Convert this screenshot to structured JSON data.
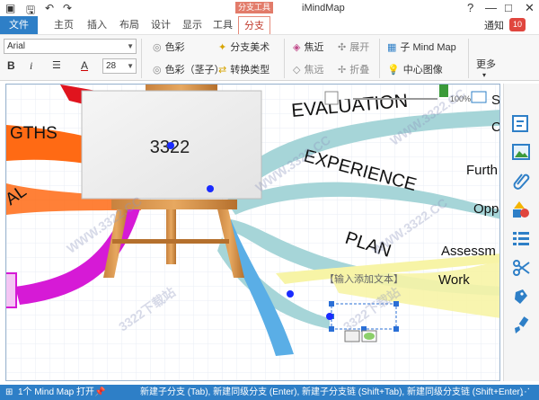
{
  "title_bar": {
    "context_tab_label": "分支工具",
    "app_title": "iMindMap",
    "help": "?",
    "minimize": "—",
    "restore": "□",
    "close": "✕"
  },
  "tabs": [
    "文件",
    "主页",
    "插入",
    "布局",
    "设计",
    "显示",
    "工具",
    "分支"
  ],
  "notifications": {
    "label": "通知",
    "count": "10"
  },
  "ribbon": {
    "font_name": "Arial",
    "font_size": "28",
    "bold": "B",
    "italic": "i",
    "color_a": "A",
    "branch_color": "色彩",
    "branch_color_stem": "色彩（茎子）",
    "branch_art": "分支美术",
    "convert_type": "转换类型",
    "focus_in": "焦近",
    "focus_out": "焦远",
    "expand": "展开",
    "collapse": "折叠",
    "sub_mindmap": "子 Mind Map",
    "center_image": "中心图像",
    "more": "更多"
  },
  "canvas": {
    "central_text": "3322",
    "placeholder_text": "【输入添加文本】",
    "zoom": "100%",
    "branches": {
      "evaluation": "EVALUATION",
      "experience": "EXPERIENCE",
      "plan": "PLAN",
      "gths": "GTHS",
      "al": "AL",
      "further": "Furth",
      "opp": "Opp",
      "assess": "Assessm",
      "work": "Work",
      "c": "C",
      "s": "S"
    },
    "watermarks": [
      "WWW.3322.CC",
      "3322下载站",
      "WWW.3322.CC",
      "3322下载站",
      "WWW.3322.CC",
      "WWW.3322.CC"
    ]
  },
  "status_bar": {
    "open_maps": "1个 Mind Map 打开",
    "hint": "新建子分支 (Tab), 新建同级分支 (Enter), 新建子分支链 (Shift+Tab), 新建同级分支链 (Shift+Enter)"
  },
  "colors": {
    "accent": "#2e7fc7",
    "context_tab": "#e27b6a",
    "badge": "#e0463e",
    "branch_teal": "#a6d5d8",
    "branch_yellow": "#f7f4a6",
    "branch_orange": "#ff6a14",
    "branch_magenta": "#d61ad6",
    "branch_red": "#e0141e",
    "branch_blue": "#5aaee6"
  }
}
